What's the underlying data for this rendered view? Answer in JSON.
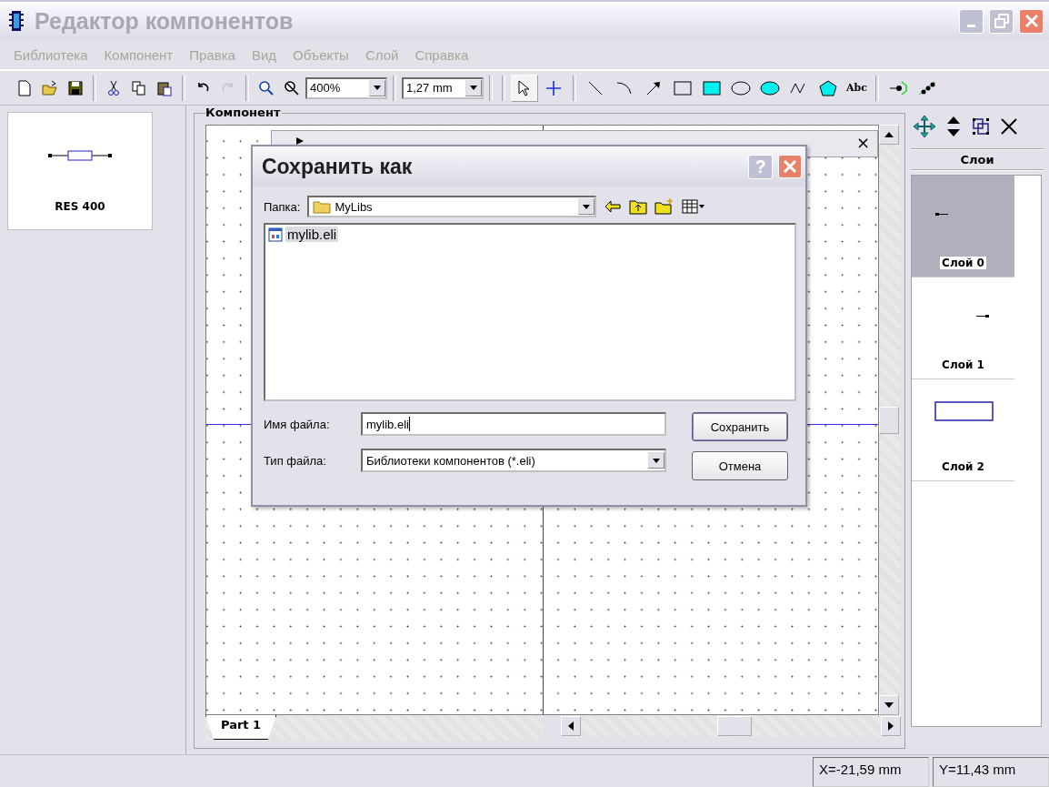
{
  "window": {
    "title": "Редактор компонентов"
  },
  "menu": [
    {
      "label": "Библиотека",
      "disabled": true
    },
    {
      "label": "Компонент",
      "disabled": true
    },
    {
      "label": "Правка",
      "disabled": true
    },
    {
      "label": "Вид",
      "disabled": true
    },
    {
      "label": "Объекты",
      "disabled": true
    },
    {
      "label": "Слой",
      "disabled": true
    },
    {
      "label": "Справка",
      "disabled": true
    }
  ],
  "edit_tools": [
    {
      "kind": "new",
      "disabled": false
    },
    {
      "kind": "open",
      "disabled": false
    },
    {
      "kind": "save",
      "disabled": false
    },
    {
      "kind": "cut",
      "disabled": false
    },
    {
      "kind": "copy",
      "disabled": false
    },
    {
      "kind": "paste",
      "disabled": false
    },
    {
      "kind": "undo",
      "disabled": false
    },
    {
      "kind": "redo",
      "disabled": true
    },
    {
      "kind": "zoom-in",
      "disabled": false
    },
    {
      "kind": "zoom-fit",
      "disabled": false
    }
  ],
  "zoom": "400%",
  "grid_step": "1,27 mm",
  "drawing_tools": [
    {
      "kind": "pointer",
      "selected": true
    },
    {
      "kind": "cross",
      "selected": false
    },
    {
      "kind": "line",
      "selected": false
    },
    {
      "kind": "arc",
      "selected": false
    },
    {
      "kind": "arrow",
      "selected": false
    },
    {
      "kind": "rect",
      "selected": false
    },
    {
      "kind": "rect-filled",
      "selected": false
    },
    {
      "kind": "ellipse",
      "selected": false
    },
    {
      "kind": "ellipse-filled",
      "selected": false
    },
    {
      "kind": "polyline",
      "selected": false
    },
    {
      "kind": "polygon",
      "selected": false
    },
    {
      "kind": "text",
      "label": "Abc",
      "selected": false
    },
    {
      "kind": "pin",
      "selected": false
    },
    {
      "kind": "pins",
      "selected": false
    }
  ],
  "library": {
    "components": [
      {
        "name": "RES 400"
      }
    ]
  },
  "editor": {
    "title": "Компонент",
    "tabs": [
      {
        "label": "Part 1",
        "selected": true
      }
    ]
  },
  "properties_panel": {
    "close": "×"
  },
  "layers": {
    "title": "Слои",
    "items": [
      {
        "name": "Слой 0",
        "selected": true,
        "kind": "pin-left"
      },
      {
        "name": "Слой 1",
        "selected": false,
        "kind": "pin-right"
      },
      {
        "name": "Слой 2",
        "selected": false,
        "kind": "rectangle"
      }
    ]
  },
  "dialog": {
    "title": "Сохранить как",
    "help": "?",
    "folder_label": "Папка:",
    "folder": "MyLibs",
    "files": [
      {
        "name": "mylib.eli",
        "selected": true
      }
    ],
    "filename_label": "Имя файла:",
    "filename": "mylib.eli",
    "filetype_label": "Тип файла:",
    "filetype": "Библиотеки компонентов (*.eli)",
    "buttons": [
      "Сохранить",
      "Отмена"
    ]
  },
  "status_bar": {
    "x": "X=-21,59 mm",
    "y": "Y=11,43 mm"
  }
}
